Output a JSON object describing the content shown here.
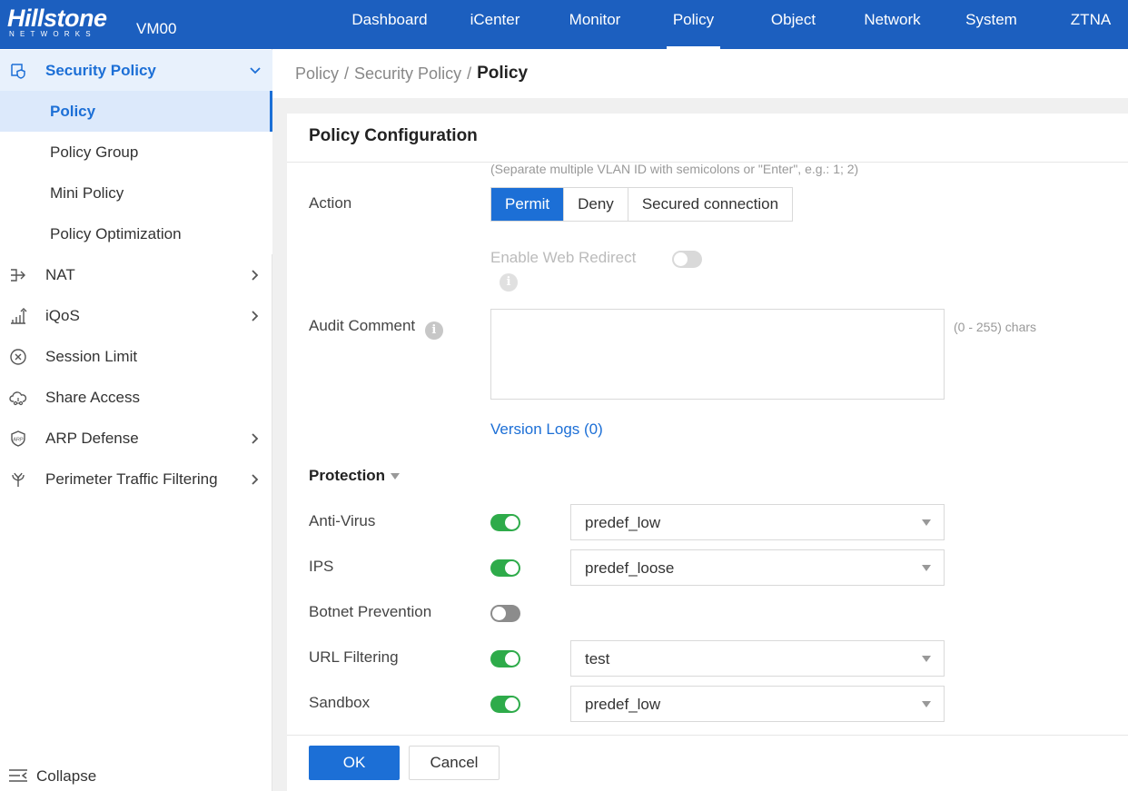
{
  "brand": {
    "logo": "Hillstone",
    "logo_sub": "NETWORKS",
    "device": "VM00"
  },
  "nav": [
    "Dashboard",
    "iCenter",
    "Monitor",
    "Policy",
    "Object",
    "Network",
    "System",
    "ZTNA"
  ],
  "nav_active": "Policy",
  "sidebar": {
    "group": {
      "label": "Security Policy",
      "icon": "shield-icon"
    },
    "sub_items": [
      "Policy",
      "Policy Group",
      "Mini Policy",
      "Policy Optimization"
    ],
    "active_sub": "Policy",
    "items": [
      {
        "label": "NAT",
        "icon": "nat-arrow-icon",
        "has_children": true
      },
      {
        "label": "iQoS",
        "icon": "bar-chart-icon",
        "has_children": true
      },
      {
        "label": "Session Limit",
        "icon": "circle-x-icon",
        "has_children": false
      },
      {
        "label": "Share Access",
        "icon": "cloud-share-icon",
        "has_children": false
      },
      {
        "label": "ARP Defense",
        "icon": "arp-shield-icon",
        "has_children": true
      },
      {
        "label": "Perimeter Traffic Filtering",
        "icon": "filter-fork-icon",
        "has_children": true
      }
    ],
    "collapse_label": "Collapse"
  },
  "breadcrumb": {
    "parts": [
      "Policy",
      "Security Policy"
    ],
    "current": "Policy"
  },
  "panel": {
    "title": "Policy Configuration",
    "vlan_hint": "(Separate multiple VLAN ID with semicolons or \"Enter\", e.g.: 1; 2)",
    "action_label": "Action",
    "action_options": [
      "Permit",
      "Deny",
      "Secured connection"
    ],
    "action_selected": "Permit",
    "web_redirect_label": "Enable Web Redirect",
    "web_redirect_enabled": false,
    "audit_label": "Audit Comment",
    "audit_value": "",
    "audit_chars": "(0 - 255) chars",
    "version_logs": "Version Logs (0)",
    "protection_label": "Protection",
    "protection": [
      {
        "label": "Anti-Virus",
        "enabled": true,
        "profile": "predef_low"
      },
      {
        "label": "IPS",
        "enabled": true,
        "profile": "predef_loose"
      },
      {
        "label": "Botnet Prevention",
        "enabled": false,
        "profile": null
      },
      {
        "label": "URL Filtering",
        "enabled": true,
        "profile": "test"
      },
      {
        "label": "Sandbox",
        "enabled": true,
        "profile": "predef_low"
      }
    ],
    "ok_label": "OK",
    "cancel_label": "Cancel"
  },
  "colors": {
    "topbar": "#1c5fbf",
    "accent": "#1c6fd6",
    "toggle_on": "#2eab4a",
    "toggle_off": "#8c8c8c"
  }
}
